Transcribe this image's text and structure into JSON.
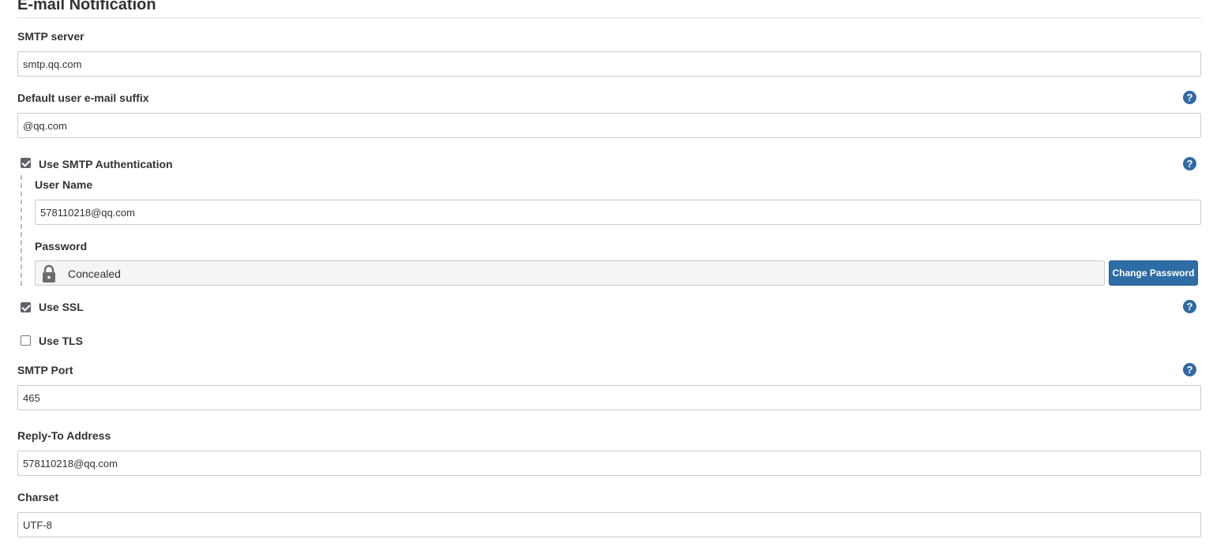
{
  "section": {
    "title": "E-mail Notification"
  },
  "fields": {
    "smtp_server": {
      "label": "SMTP server",
      "value": "smtp.qq.com"
    },
    "default_suffix": {
      "label": "Default user e-mail suffix",
      "value": "@qq.com"
    },
    "use_smtp_auth": {
      "label": "Use SMTP Authentication",
      "checked": true
    },
    "user_name": {
      "label": "User Name",
      "value": "578110218@qq.com"
    },
    "password": {
      "label": "Password",
      "concealed_text": "Concealed",
      "change_button": "Change Password"
    },
    "use_ssl": {
      "label": "Use SSL",
      "checked": true
    },
    "use_tls": {
      "label": "Use TLS",
      "checked": false
    },
    "smtp_port": {
      "label": "SMTP Port",
      "value": "465"
    },
    "reply_to": {
      "label": "Reply-To Address",
      "value": "578110218@qq.com"
    },
    "charset": {
      "label": "Charset",
      "value": "UTF-8"
    }
  },
  "help_icon": {
    "glyph": "?",
    "color": "#2f6aa3"
  },
  "colors": {
    "button": "#2e6ca5",
    "checkbox_checked": "#5f6368"
  }
}
